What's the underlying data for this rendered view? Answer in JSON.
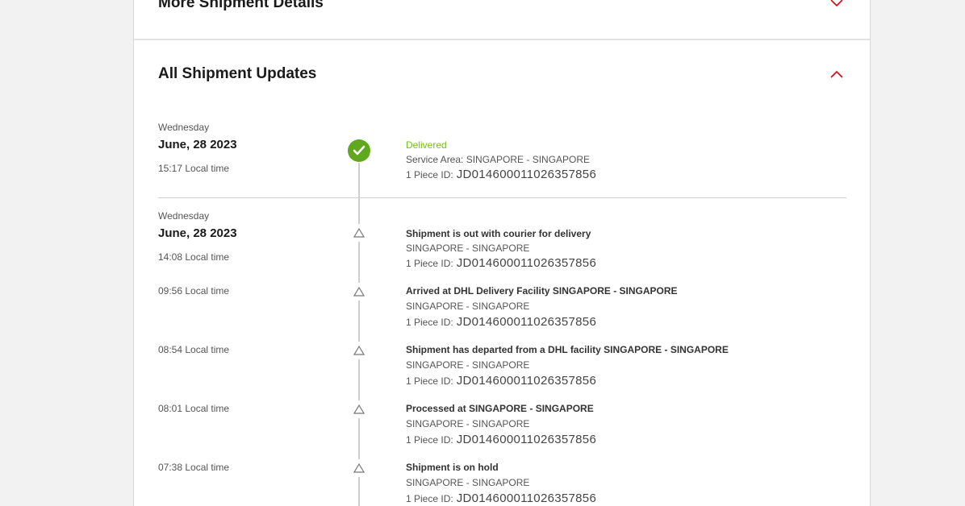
{
  "more_details": {
    "title": "More Shipment Details"
  },
  "updates": {
    "title": "All Shipment Updates"
  },
  "colors": {
    "delivered": "#76bd22",
    "accent": "#d40511"
  },
  "icons": {
    "expand": "chevron-down-icon",
    "collapse": "chevron-up-icon",
    "delivered": "check-icon",
    "event": "triangle-icon"
  },
  "groups": [
    {
      "day": "Wednesday",
      "date": "June, 28 2023",
      "events": [
        {
          "time": "15:17 Local time",
          "status": "Delivered",
          "location": "Service Area: SINGAPORE - SINGAPORE",
          "piece_label": "1 Piece ID:",
          "piece_id": "JD014600011026357856"
        }
      ]
    },
    {
      "day": "Wednesday",
      "date": "June, 28 2023",
      "events": [
        {
          "time": "14:08 Local time",
          "status": "Shipment is out with courier for delivery",
          "location": "SINGAPORE - SINGAPORE",
          "piece_label": "1 Piece ID:",
          "piece_id": "JD014600011026357856"
        },
        {
          "time": "09:56 Local time",
          "status": "Arrived at DHL Delivery Facility SINGAPORE - SINGAPORE",
          "location": "SINGAPORE - SINGAPORE",
          "piece_label": "1 Piece ID:",
          "piece_id": "JD014600011026357856"
        },
        {
          "time": "08:54 Local time",
          "status": "Shipment has departed from a DHL facility SINGAPORE - SINGAPORE",
          "location": "SINGAPORE - SINGAPORE",
          "piece_label": "1 Piece ID:",
          "piece_id": "JD014600011026357856"
        },
        {
          "time": "08:01 Local time",
          "status": "Processed at SINGAPORE - SINGAPORE",
          "location": "SINGAPORE - SINGAPORE",
          "piece_label": "1 Piece ID:",
          "piece_id": "JD014600011026357856"
        },
        {
          "time": "07:38 Local time",
          "status": "Shipment is on hold",
          "location": "SINGAPORE - SINGAPORE",
          "piece_label": "1 Piece ID:",
          "piece_id": "JD014600011026357856"
        }
      ]
    }
  ]
}
